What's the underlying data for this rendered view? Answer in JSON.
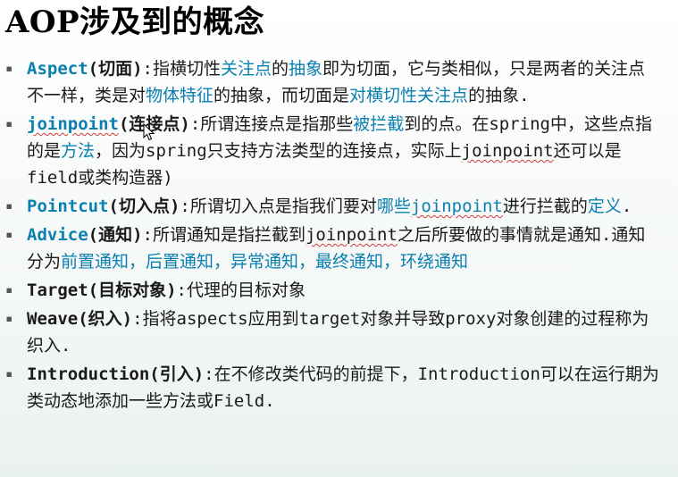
{
  "title": "AOP涉及到的概念",
  "bullet_glyph": "▪",
  "items": [
    {
      "term": "Aspect",
      "paren": "(切面)",
      "segments": [
        {
          "t": ":指横切性",
          "hl": false
        },
        {
          "t": "关注点",
          "hl": true
        },
        {
          "t": "的",
          "hl": false
        },
        {
          "t": "抽象",
          "hl": true
        },
        {
          "t": "即为切面，它与类相似，只是两者的关注点不一样，类是对",
          "hl": false
        },
        {
          "t": "物体特征",
          "hl": true
        },
        {
          "t": "的抽象，而切面是",
          "hl": false
        },
        {
          "t": "对横切性关注点",
          "hl": true
        },
        {
          "t": "的抽象.",
          "hl": false
        }
      ]
    },
    {
      "term": "joinpoint",
      "paren": "(连接点)",
      "segments": [
        {
          "t": ":所谓连接点是指那些",
          "hl": false
        },
        {
          "t": "被拦截",
          "hl": true
        },
        {
          "t": "到的点。在spring中，这些点指的是",
          "hl": false
        },
        {
          "t": "方法",
          "hl": true
        },
        {
          "t": "，因为spring只支持方法类型的连接点，实际上",
          "hl": false
        },
        {
          "t": "joinpoint",
          "hl": false,
          "ul": true
        },
        {
          "t": "还可以是field或类构造器)",
          "hl": false
        }
      ]
    },
    {
      "term": "Pointcut",
      "paren": "(切入点)",
      "segments": [
        {
          "t": ":所谓切入点是指我们要对",
          "hl": false
        },
        {
          "t": "哪些",
          "hl": true
        },
        {
          "t": "joinpoint",
          "hl": true,
          "ul": true
        },
        {
          "t": "进行拦截的",
          "hl": false
        },
        {
          "t": "定义",
          "hl": true
        },
        {
          "t": ".",
          "hl": false
        }
      ]
    },
    {
      "term": "Advice",
      "paren": "(通知)",
      "segments": [
        {
          "t": ":所谓通知是指拦截到",
          "hl": false
        },
        {
          "t": "joinpoint",
          "hl": false,
          "ul": true
        },
        {
          "t": "之后所要做的事情就是通知.通知分为",
          "hl": false
        },
        {
          "t": "前置通知，后置通知，异常通知，最终通知，环绕通知",
          "hl": true
        }
      ]
    },
    {
      "term": "Target",
      "paren": "(目标对象)",
      "dark": true,
      "segments": [
        {
          "t": ":代理的目标对象",
          "hl": false
        }
      ]
    },
    {
      "term": "Weave",
      "paren": "(织入)",
      "dark": true,
      "segments": [
        {
          "t": ":指将aspects应用到target对象并导致proxy对象创建的过程称为织入.",
          "hl": false
        }
      ]
    },
    {
      "term": "Introduction",
      "paren": "(引入)",
      "dark": true,
      "segments": [
        {
          "t": ":在不修改类代码的前提下，Introduction可以在运行期为类动态地添加一些方法或Field.",
          "hl": false
        }
      ]
    }
  ],
  "colors": {
    "accent": "#0a7fb0",
    "underline": "#d23a3a",
    "text": "#1a1a1a"
  }
}
